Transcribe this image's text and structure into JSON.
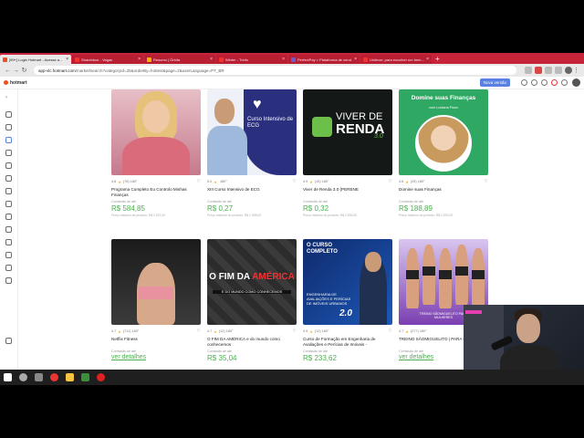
{
  "browser": {
    "tabs": [
      {
        "title": "[99+] Login Hotmart - Acesse a...",
        "active": true,
        "color": "#ef4e23"
      },
      {
        "title": "Shareidoor - Vagas",
        "active": false,
        "color": "#e33"
      },
      {
        "title": "Resumo | Órbita",
        "active": false,
        "color": "#f7b500"
      },
      {
        "title": "Winter - Trello",
        "active": false,
        "color": "#e33"
      },
      {
        "title": "PerfectPay > Plataforma de vend...",
        "active": false,
        "color": "#6a5acd"
      },
      {
        "title": "Unilever, para escolher um bem...",
        "active": false,
        "color": "#e33"
      }
    ],
    "new_tab": "+",
    "url_host": "app-vlc.hotmart.com",
    "url_path": "/market/search?categoryId=25&orderBy=hottest&page=2&userLanguage=PT_BR"
  },
  "app": {
    "logo_text": "hotmart",
    "new_version_label": "Nova versão"
  },
  "cards": [
    {
      "rating": "4.8",
      "reviews": "(78)",
      "temp": "180°",
      "title": "Programa Completo Eu Controlo Minhas Finanças",
      "commission_label": "Comissão de até",
      "price": "R$ 584,85",
      "max_price": "Preço máximo do produto: R$ 2.537,00"
    },
    {
      "rating": "5.0",
      "reviews": "",
      "temp": "180°",
      "title": "XIII Curso Intensivo de ECG",
      "commission_label": "Comissão de até",
      "price": "R$ 0,27",
      "max_price": "Preço máximo do produto: R$ 1.998,00"
    },
    {
      "rating": "4.9",
      "reviews": "(15)",
      "temp": "180°",
      "title": "Viver de Renda 3.0 (PERENE",
      "commission_label": "Comissão de até",
      "price": "R$ 0,32",
      "max_price": "Preço máximo do produto: R$ 2.550,00"
    },
    {
      "rating": "4.6",
      "reviews": "(25)",
      "temp": "180°",
      "title": "Domine suas Finanças",
      "commission_label": "Comissão de até",
      "price": "R$ 188,89",
      "max_price": "Preço máximo do produto: R$ 2.592,00"
    },
    {
      "rating": "4.7",
      "reviews": "(711)",
      "temp": "180°",
      "title": "Netflix Fitness",
      "commission_label": "Comissão de até",
      "price": "",
      "details": "ver detalhes"
    },
    {
      "rating": "4.7",
      "reviews": "(12)",
      "temp": "180°",
      "title": "O FIM DA AMÉRICA e do mundo como conhecemos",
      "commission_label": "Comissão de até",
      "price": "R$ 35,04"
    },
    {
      "rating": "4.9",
      "reviews": "(12)",
      "temp": "180°",
      "title": "Curso de Formação em Engenharia de Avaliações e Perícias de Imóveis -",
      "commission_label": "Comissão de até",
      "price": "R$ 233,62"
    },
    {
      "rating": "4.7",
      "reviews": "(277)",
      "temp": "180°",
      "title": "TREINO SÃOMIGUELITO | PARA MULHERES",
      "commission_label": "Comissão de até",
      "price": "",
      "details": "ver detalhes"
    }
  ],
  "thumbs": {
    "ecg_title": "Curso Intensivo de ECG",
    "vdr_line1": "VIVER DE",
    "vdr_line2": "RENDA",
    "vdr_version": "3.0",
    "fin_title": "Domine suas Finanças",
    "fin_sub": "com Luciana Fioux",
    "fim_title_a": "O FIM DA ",
    "fim_title_b": "AMÉRICA",
    "fim_sub": "E DO MUNDO COMO CONHECEMOS",
    "cc_title": "O CURSO COMPLETO",
    "cc_sub": "ENGENHARIA DE AVALIAÇÕES E PERÍCIAS DE IMÓVEIS URBANOS",
    "cc_version": "2.0",
    "tr_label": "TREINO SÃOMIGUELITO PARA MULHERES"
  }
}
